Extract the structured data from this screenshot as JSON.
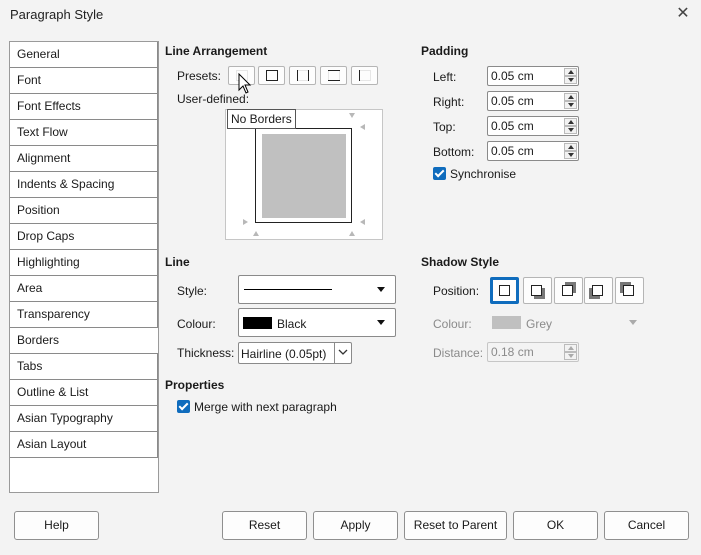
{
  "window": {
    "title": "Paragraph Style"
  },
  "sidebar": {
    "items": [
      {
        "label": "General"
      },
      {
        "label": "Font"
      },
      {
        "label": "Font Effects"
      },
      {
        "label": "Text Flow"
      },
      {
        "label": "Alignment"
      },
      {
        "label": "Indents & Spacing"
      },
      {
        "label": "Position"
      },
      {
        "label": "Drop Caps"
      },
      {
        "label": "Highlighting"
      },
      {
        "label": "Area"
      },
      {
        "label": "Transparency"
      },
      {
        "label": "Borders"
      },
      {
        "label": "Tabs"
      },
      {
        "label": "Outline & List"
      },
      {
        "label": "Asian Typography"
      },
      {
        "label": "Asian Layout"
      }
    ],
    "active": "Borders"
  },
  "line_arrangement": {
    "title": "Line Arrangement",
    "presets_label": "Presets:",
    "user_defined_label": "User-defined:",
    "tooltip": "No Borders",
    "preset_icons": [
      "no-borders-icon",
      "all-borders-icon",
      "left-right-borders-icon",
      "top-bottom-borders-icon",
      "left-border-icon"
    ]
  },
  "padding": {
    "title": "Padding",
    "left": {
      "label": "Left:",
      "value": "0.05 cm"
    },
    "right": {
      "label": "Right:",
      "value": "0.05 cm"
    },
    "top": {
      "label": "Top:",
      "value": "0.05 cm"
    },
    "bottom": {
      "label": "Bottom:",
      "value": "0.05 cm"
    },
    "synchronise": {
      "label": "Synchronise",
      "checked": true
    }
  },
  "line": {
    "title": "Line",
    "style_label": "Style:",
    "colour_label": "Colour:",
    "colour_value": "Black",
    "colour_swatch": "#000000",
    "thickness_label": "Thickness:",
    "thickness_value": "Hairline (0.05pt)"
  },
  "shadow": {
    "title": "Shadow Style",
    "position_label": "Position:",
    "position_icons": [
      "no-shadow-icon",
      "shadow-bottom-right-icon",
      "shadow-top-right-icon",
      "shadow-bottom-left-icon",
      "shadow-top-left-icon"
    ],
    "colour_label": "Colour:",
    "colour_value": "Grey",
    "colour_swatch": "#c0c0c0",
    "distance_label": "Distance:",
    "distance_value": "0.18 cm"
  },
  "properties": {
    "title": "Properties",
    "merge_label": "Merge with next paragraph",
    "merge_checked": true
  },
  "buttons": {
    "help": "Help",
    "reset": "Reset",
    "apply": "Apply",
    "reset_to_parent": "Reset to Parent",
    "ok": "OK",
    "cancel": "Cancel"
  },
  "accent_color": "#0f6cbd"
}
